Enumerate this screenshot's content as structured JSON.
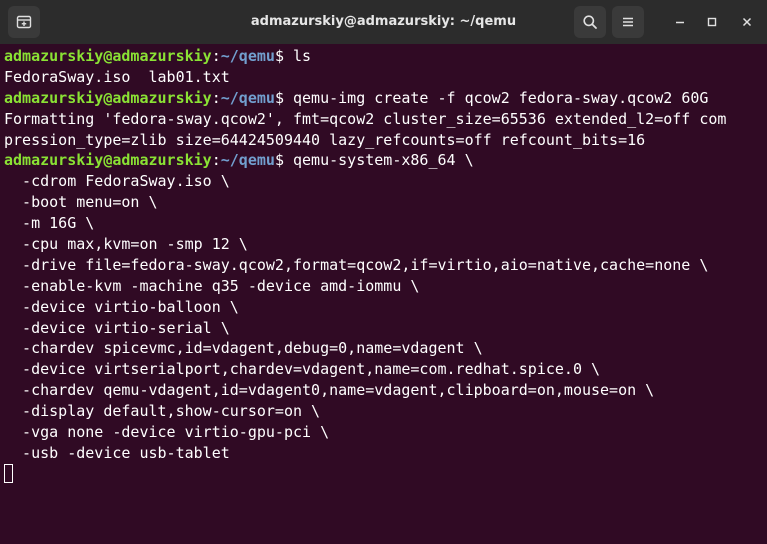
{
  "window": {
    "title": "admazurskiy@admazurskiy: ~/qemu"
  },
  "titlebar": {
    "new_tab_icon": "new-tab-icon",
    "search_icon": "search-icon",
    "menu_icon": "hamburger-menu-icon",
    "minimize_icon": "minimize-icon",
    "maximize_icon": "maximize-icon",
    "close_icon": "close-icon"
  },
  "colors": {
    "background": "#300a24",
    "prompt_user": "#8ae234",
    "prompt_path": "#729fcf",
    "text": "#ffffff",
    "titlebar": "#2c2c2c"
  },
  "terminal": {
    "prompt_user": "admazurskiy@admazurskiy",
    "prompt_sep": ":",
    "prompt_path": "~/qemu",
    "prompt_end": "$ ",
    "lines": [
      {
        "type": "prompt",
        "cmd": "ls"
      },
      {
        "type": "output",
        "text": "FedoraSway.iso  lab01.txt"
      },
      {
        "type": "prompt",
        "cmd": "qemu-img create -f qcow2 fedora-sway.qcow2 60G"
      },
      {
        "type": "output",
        "text": "Formatting 'fedora-sway.qcow2', fmt=qcow2 cluster_size=65536 extended_l2=off com"
      },
      {
        "type": "output",
        "text": "pression_type=zlib size=64424509440 lazy_refcounts=off refcount_bits=16"
      },
      {
        "type": "prompt",
        "cmd": "qemu-system-x86_64 \\"
      },
      {
        "type": "output",
        "text": "  -cdrom FedoraSway.iso \\"
      },
      {
        "type": "output",
        "text": "  -boot menu=on \\"
      },
      {
        "type": "output",
        "text": "  -m 16G \\"
      },
      {
        "type": "output",
        "text": "  -cpu max,kvm=on -smp 12 \\"
      },
      {
        "type": "output",
        "text": "  -drive file=fedora-sway.qcow2,format=qcow2,if=virtio,aio=native,cache=none \\"
      },
      {
        "type": "output",
        "text": "  -enable-kvm -machine q35 -device amd-iommu \\"
      },
      {
        "type": "output",
        "text": "  -device virtio-balloon \\"
      },
      {
        "type": "output",
        "text": "  -device virtio-serial \\"
      },
      {
        "type": "output",
        "text": "  -chardev spicevmc,id=vdagent,debug=0,name=vdagent \\"
      },
      {
        "type": "output",
        "text": "  -device virtserialport,chardev=vdagent,name=com.redhat.spice.0 \\"
      },
      {
        "type": "output",
        "text": "  -chardev qemu-vdagent,id=vdagent0,name=vdagent,clipboard=on,mouse=on \\"
      },
      {
        "type": "output",
        "text": "  -display default,show-cursor=on \\"
      },
      {
        "type": "output",
        "text": "  -vga none -device virtio-gpu-pci \\"
      },
      {
        "type": "output",
        "text": "  -usb -device usb-tablet"
      }
    ]
  }
}
